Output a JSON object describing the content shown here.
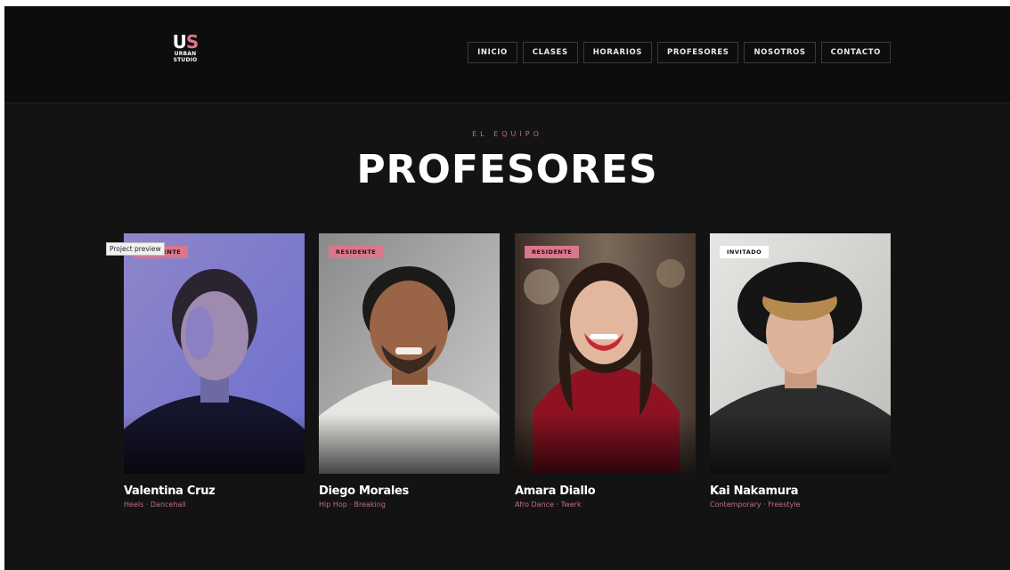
{
  "brand": {
    "mark_u": "U",
    "mark_s": "S",
    "line1": "URBAN",
    "line2": "STUDIO",
    "accent": "#d9778c"
  },
  "nav": {
    "items": [
      {
        "label": "INICIO"
      },
      {
        "label": "CLASES"
      },
      {
        "label": "HORARIOS"
      },
      {
        "label": "PROFESORES"
      },
      {
        "label": "NOSOTROS"
      },
      {
        "label": "CONTACTO"
      }
    ]
  },
  "hero": {
    "eyebrow": "EL EQUIPO",
    "title": "PROFESORES"
  },
  "tooltip": "Project preview",
  "teachers": [
    {
      "badge": "RESIDENTE",
      "name": "Valentina Cruz",
      "styles": "Heels · Dancehall"
    },
    {
      "badge": "RESIDENTE",
      "name": "Diego Morales",
      "styles": "Hip Hop · Breaking"
    },
    {
      "badge": "RESIDENTE",
      "name": "Amara Diallo",
      "styles": "Afro Dance · Twerk"
    },
    {
      "badge": "INVITADO",
      "name": "Kai Nakamura",
      "styles": "Contemporary · Freestyle"
    }
  ],
  "colors": {
    "background": "#131313",
    "header": "#0d0d0d",
    "pink": "#c26e83",
    "text": "#ffffff"
  }
}
